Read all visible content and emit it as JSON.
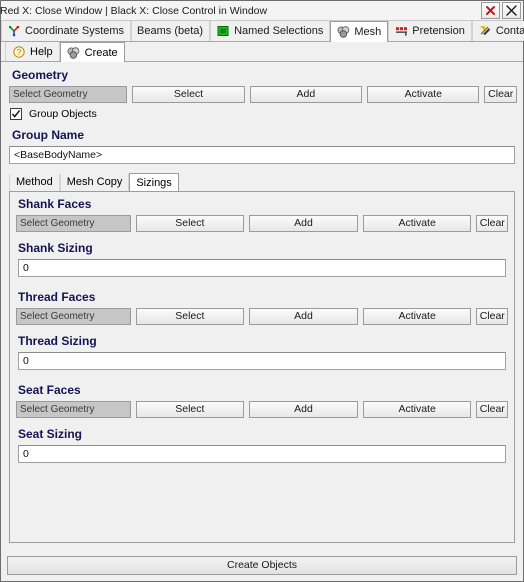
{
  "window": {
    "title": "Red X: Close Window | Black X: Close Control in Window",
    "close_window_button": "red-x",
    "close_control_button": "black-x"
  },
  "main_tabs": [
    {
      "label": "Coordinate Systems",
      "icon": "coordinate-systems-icon",
      "selected": false
    },
    {
      "label": "Beams (beta)",
      "icon": "",
      "selected": false
    },
    {
      "label": "Named Selections",
      "icon": "named-selections-icon",
      "selected": false
    },
    {
      "label": "Mesh",
      "icon": "mesh-icon",
      "selected": true
    },
    {
      "label": "Pretension",
      "icon": "pretension-icon",
      "selected": false
    },
    {
      "label": "Contacts",
      "icon": "contacts-icon",
      "selected": false
    }
  ],
  "sub_tabs": [
    {
      "label": "Help",
      "icon": "help-icon",
      "selected": false
    },
    {
      "label": "Create",
      "icon": "mesh-icon",
      "selected": true
    }
  ],
  "geometry": {
    "heading": "Geometry",
    "picker_value": "Select Geometry",
    "buttons": [
      "Select",
      "Add",
      "Activate",
      "Clear"
    ],
    "group_objects_label": "Group Objects",
    "group_objects_checked": true
  },
  "group_name": {
    "heading": "Group Name",
    "value": "<BaseBodyName>"
  },
  "panel_tabs": [
    {
      "label": "Method",
      "selected": false
    },
    {
      "label": "Mesh Copy",
      "selected": false
    },
    {
      "label": "Sizings",
      "selected": true
    }
  ],
  "sizings": [
    {
      "faces_heading": "Shank Faces",
      "picker_value": "Select Geometry",
      "buttons": [
        "Select",
        "Add",
        "Activate",
        "Clear"
      ],
      "sizing_heading": "Shank Sizing",
      "sizing_value": "0"
    },
    {
      "faces_heading": "Thread Faces",
      "picker_value": "Select Geometry",
      "buttons": [
        "Select",
        "Add",
        "Activate",
        "Clear"
      ],
      "sizing_heading": "Thread Sizing",
      "sizing_value": "0"
    },
    {
      "faces_heading": "Seat Faces",
      "picker_value": "Select Geometry",
      "buttons": [
        "Select",
        "Add",
        "Activate",
        "Clear"
      ],
      "sizing_heading": "Seat Sizing",
      "sizing_value": "0"
    }
  ],
  "footer": {
    "create_objects_label": "Create Objects"
  },
  "colors": {
    "heading": "#141452",
    "panel_bg": "#f0f0f0",
    "field_bg": "#c6c6c6",
    "close_red": "#d01414",
    "selected_tab_bg": "#ffffff"
  }
}
